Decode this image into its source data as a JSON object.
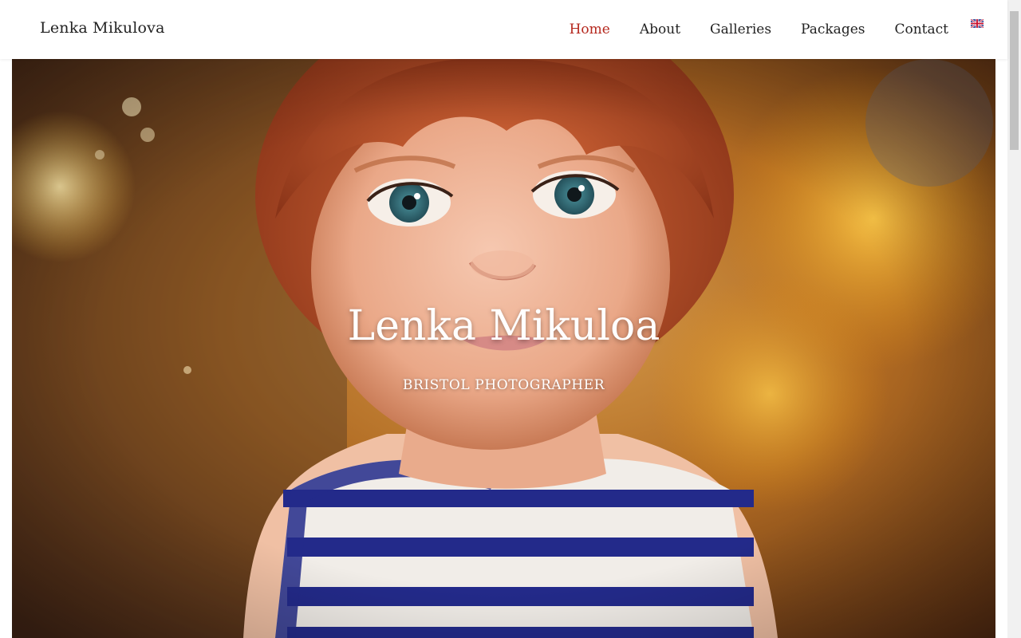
{
  "header": {
    "logo": "Lenka Mikulova",
    "nav": [
      {
        "label": "Home",
        "active": true
      },
      {
        "label": "About",
        "active": false
      },
      {
        "label": "Galleries",
        "active": false
      },
      {
        "label": "Packages",
        "active": false
      },
      {
        "label": "Contact",
        "active": false
      }
    ],
    "language_icon": "uk-flag-icon"
  },
  "hero": {
    "title": "Lenka Mikuloa",
    "subtitle": "BRISTOL PHOTOGRAPHER",
    "image": "portrait-photo"
  },
  "colors": {
    "accent": "#b5281e",
    "text": "#222222"
  }
}
